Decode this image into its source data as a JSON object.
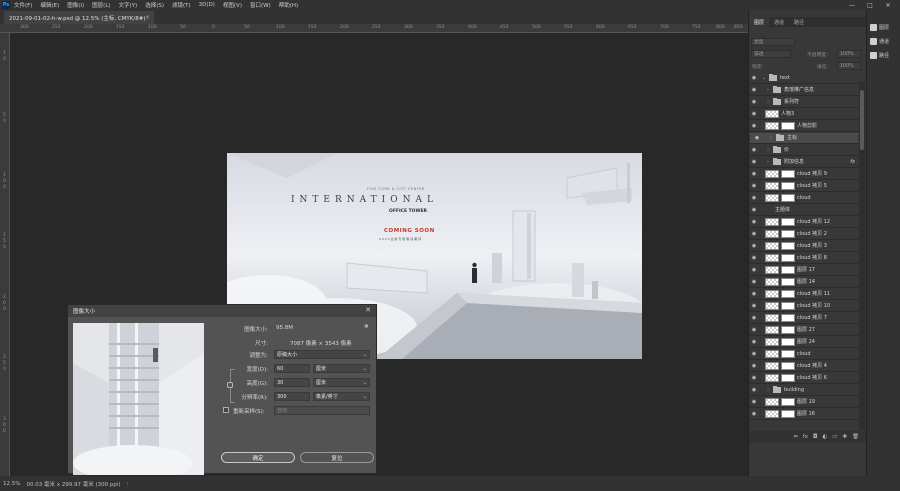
{
  "app": {
    "logo": "Ps"
  },
  "menu": [
    "文件(F)",
    "编辑(E)",
    "图像(I)",
    "图层(L)",
    "文字(Y)",
    "选择(S)",
    "滤镜(T)",
    "3D(D)",
    "视图(V)",
    "窗口(W)",
    "帮助(H)"
  ],
  "window_controls": {
    "minimize": "—",
    "maximize": "□",
    "close": "✕"
  },
  "doc_tab": {
    "title": "2021-09-01-02-h-w.psd @ 12.5% (主标, CMYK/8#)",
    "close": "×"
  },
  "ruler_h": [
    "300",
    "250",
    "200",
    "150",
    "100",
    "50",
    "0",
    "50",
    "100",
    "150",
    "200",
    "250",
    "300",
    "350",
    "400",
    "450",
    "500",
    "550",
    "600",
    "650",
    "700",
    "750",
    "800",
    "850"
  ],
  "ruler_v": [
    "1",
    "0",
    "5",
    "0",
    "1",
    "0",
    "0",
    "1",
    "5",
    "0",
    "2",
    "0",
    "0",
    "2",
    "5",
    "0",
    "3",
    "0",
    "0"
  ],
  "canvas_art": {
    "small_line": "FIVE CORE & CITY CENTER",
    "title": "INTERNATIONAL",
    "subtitle": "OFFICE TOWER",
    "coming": "COMING SOON",
    "coming_sub": "2 0 2 1 全 新 升 级 敬 请 期 待",
    "accent": "#c0392b"
  },
  "status": {
    "zoom": "12.5%",
    "info": "00.03 毫米 x 299.97 毫米 (300 ppi)",
    "arrow": "›"
  },
  "dialog": {
    "title": "图像大小",
    "close": "✕",
    "size_label": "图像大小:",
    "size_value": "95.8M",
    "dim_label": "尺寸:",
    "dim_value": "7087 像素 × 3543 像素",
    "fit_label": "调整为:",
    "fit_value": "原稿大小",
    "width_label": "宽度(D):",
    "width_value": "60",
    "width_unit": "厘米",
    "height_label": "高度(G):",
    "height_value": "30",
    "height_unit": "厘米",
    "res_label": "分辨率(R):",
    "res_value": "300",
    "res_unit": "像素/英寸",
    "resample_label": "重新采样(S):",
    "resample_value": "自动",
    "ok": "确定",
    "reset": "复位",
    "gear": "✻",
    "dropdown_arrow": "⌄"
  },
  "panel": {
    "tabs": [
      "图层",
      "通道",
      "路径"
    ],
    "search_placeholder": "类型",
    "mode": "穿透",
    "opacity": "不透明度:",
    "opacity_value": "100%",
    "lock": "锁定:",
    "fill": "填充:",
    "fill_value": "100%"
  },
  "layers": [
    {
      "name": "text",
      "kind": "folder",
      "open": true
    },
    {
      "name": "角落推广信息",
      "kind": "folder"
    },
    {
      "name": "系列符",
      "kind": "folder"
    },
    {
      "name": "人物3",
      "kind": "layer"
    },
    {
      "name": "人物剪影",
      "kind": "mask"
    },
    {
      "name": "主标",
      "kind": "folder",
      "selected": true
    },
    {
      "name": "价",
      "kind": "folder"
    },
    {
      "name": "附加信息",
      "kind": "folder",
      "fx": "fx"
    },
    {
      "name": "cloud 拷贝 9",
      "kind": "mask"
    },
    {
      "name": "cloud 拷贝 5",
      "kind": "mask"
    },
    {
      "name": "cloud",
      "kind": "mask"
    },
    {
      "name": "主题体",
      "kind": "text"
    },
    {
      "name": "cloud 拷贝 12",
      "kind": "mask"
    },
    {
      "name": "cloud 拷贝 2",
      "kind": "mask"
    },
    {
      "name": "cloud 拷贝 3",
      "kind": "mask"
    },
    {
      "name": "cloud 拷贝 8",
      "kind": "mask"
    },
    {
      "name": "图层 17",
      "kind": "mask"
    },
    {
      "name": "图层 14",
      "kind": "mask"
    },
    {
      "name": "cloud 拷贝 11",
      "kind": "mask"
    },
    {
      "name": "cloud 拷贝 10",
      "kind": "mask"
    },
    {
      "name": "cloud 拷贝 7",
      "kind": "mask"
    },
    {
      "name": "图层 27",
      "kind": "mask"
    },
    {
      "name": "图层 24",
      "kind": "mask"
    },
    {
      "name": "cloud",
      "kind": "mask"
    },
    {
      "name": "cloud 拷贝 4",
      "kind": "mask"
    },
    {
      "name": "cloud 拷贝 6",
      "kind": "mask"
    },
    {
      "name": "building",
      "kind": "folder"
    },
    {
      "name": "图层 19",
      "kind": "mask"
    },
    {
      "name": "图层 16",
      "kind": "mask"
    }
  ],
  "panel_footer": [
    "⇔",
    "fx",
    "◘",
    "◐",
    "▭",
    "✚",
    "🗑"
  ],
  "dock": [
    "图层",
    "通道",
    "路径"
  ]
}
